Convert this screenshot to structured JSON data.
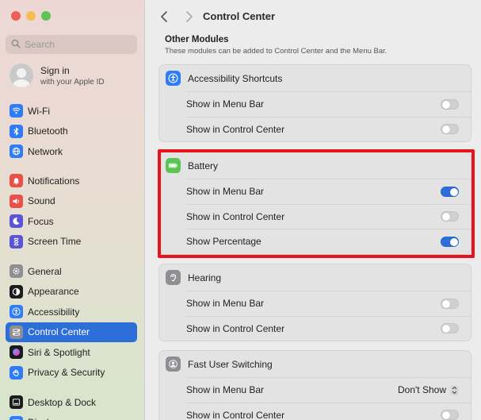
{
  "sidebar": {
    "search_placeholder": "Search",
    "account": {
      "name": "Sign in",
      "subtitle": "with your Apple ID"
    },
    "groups": [
      [
        {
          "label": "Wi-Fi",
          "icon": "wifi-icon",
          "color": "#2f7cf6"
        },
        {
          "label": "Bluetooth",
          "icon": "bluetooth-icon",
          "color": "#2f7cf6"
        },
        {
          "label": "Network",
          "icon": "globe-icon",
          "color": "#2f7cf6"
        }
      ],
      [
        {
          "label": "Notifications",
          "icon": "bell-icon",
          "color": "#e8504a"
        },
        {
          "label": "Sound",
          "icon": "speaker-icon",
          "color": "#e8504a"
        },
        {
          "label": "Focus",
          "icon": "moon-icon",
          "color": "#5a55d6"
        },
        {
          "label": "Screen Time",
          "icon": "hourglass-icon",
          "color": "#5a55d6"
        }
      ],
      [
        {
          "label": "General",
          "icon": "gear-icon",
          "color": "#8e8e93"
        },
        {
          "label": "Appearance",
          "icon": "appearance-icon",
          "color": "#1c1c1e"
        },
        {
          "label": "Accessibility",
          "icon": "accessibility-icon",
          "color": "#2f7cf6"
        },
        {
          "label": "Control Center",
          "icon": "control-center-icon",
          "color": "#8e8e93",
          "selected": true
        },
        {
          "label": "Siri & Spotlight",
          "icon": "siri-icon",
          "color": "#1c1c1e"
        },
        {
          "label": "Privacy & Security",
          "icon": "hand-icon",
          "color": "#2f7cf6"
        }
      ],
      [
        {
          "label": "Desktop & Dock",
          "icon": "dock-icon",
          "color": "#1c1c1e"
        },
        {
          "label": "Displays",
          "icon": "display-icon",
          "color": "#2f7cf6"
        }
      ]
    ]
  },
  "main": {
    "title": "Control Center",
    "section_title": "Other Modules",
    "section_desc": "These modules can be added to Control Center and the Menu Bar.",
    "modules": [
      {
        "name": "Accessibility Shortcuts",
        "icon": "accessibility-icon",
        "color": "#2f7cf6",
        "rows": [
          {
            "label": "Show in Menu Bar",
            "type": "toggle",
            "on": false
          },
          {
            "label": "Show in Control Center",
            "type": "toggle",
            "on": false
          }
        ]
      },
      {
        "name": "Battery",
        "icon": "battery-icon",
        "color": "#5cc454",
        "rows": [
          {
            "label": "Show in Menu Bar",
            "type": "toggle",
            "on": true
          },
          {
            "label": "Show in Control Center",
            "type": "toggle",
            "on": false
          },
          {
            "label": "Show Percentage",
            "type": "toggle",
            "on": true
          }
        ]
      },
      {
        "name": "Hearing",
        "icon": "ear-icon",
        "color": "#8e8e93",
        "rows": [
          {
            "label": "Show in Menu Bar",
            "type": "toggle",
            "on": false
          },
          {
            "label": "Show in Control Center",
            "type": "toggle",
            "on": false
          }
        ]
      },
      {
        "name": "Fast User Switching",
        "icon": "user-switch-icon",
        "color": "#8e8e93",
        "rows": [
          {
            "label": "Show in Menu Bar",
            "type": "select",
            "value": "Don't Show"
          },
          {
            "label": "Show in Control Center",
            "type": "toggle",
            "on": false
          }
        ]
      }
    ]
  },
  "colors": {
    "accent": "#2e6ed8",
    "highlight": "#e8141b"
  }
}
